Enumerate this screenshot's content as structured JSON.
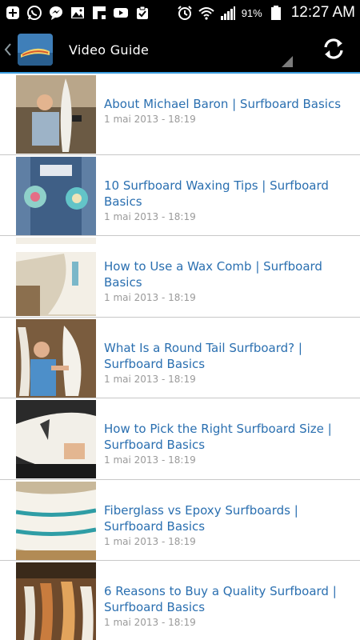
{
  "status_bar": {
    "battery_percent": "91%",
    "time": "12:27 AM",
    "icons": [
      "plus-icon",
      "whatsapp-icon",
      "messenger-icon",
      "gallery-icon",
      "flipboard-icon",
      "youtube-icon",
      "clipboard-icon",
      "alarm-icon",
      "wifi-icon",
      "signal-icon",
      "battery-icon"
    ]
  },
  "action_bar": {
    "title": "Video Guide",
    "icons": [
      "back-chevron-icon",
      "app-logo-icon",
      "refresh-icon"
    ]
  },
  "videos": [
    {
      "title": "About Michael Baron | Surfboard Basics",
      "date": "1 mai 2013 - 18:19"
    },
    {
      "title": "10 Surfboard Waxing Tips | Surfboard Basics",
      "date": "1 mai 2013 - 18:19"
    },
    {
      "title": "How to Use a Wax Comb | Surfboard Basics",
      "date": "1 mai 2013 - 18:19"
    },
    {
      "title": "What Is a Round Tail Surfboard? | Surfboard Basics",
      "date": "1 mai 2013 - 18:19"
    },
    {
      "title": "How to Pick the Right Surfboard Size | Surfboard Basics",
      "date": "1 mai 2013 - 18:19"
    },
    {
      "title": "Fiberglass vs Epoxy Surfboards | Surfboard Basics",
      "date": "1 mai 2013 - 18:19"
    },
    {
      "title": "6 Reasons to Buy a Quality Surfboard | Surfboard Basics",
      "date": "1 mai 2013 - 18:19"
    }
  ],
  "colors": {
    "title_link": "#2a6fb0",
    "date_text": "#9a9a9a",
    "accent_line": "#3b9ee0",
    "bar_background": "#000000"
  }
}
